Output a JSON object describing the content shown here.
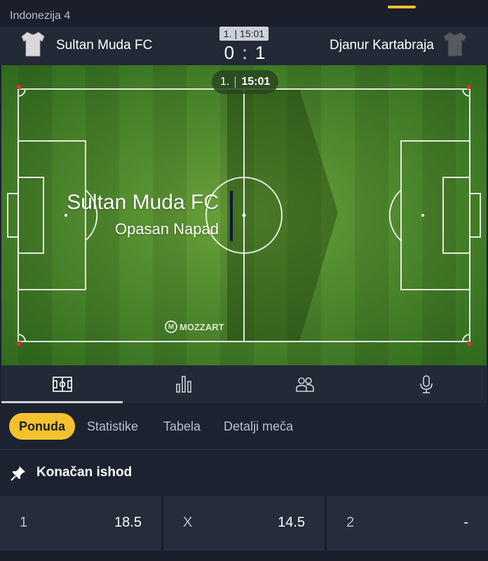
{
  "header": {
    "league": "Indonezija 4"
  },
  "match": {
    "home_team": "Sultan Muda FC",
    "away_team": "Djanur Kartabraja",
    "period": "1.",
    "clock": "15:01",
    "score_home": "0",
    "score_sep": ":",
    "score_away": "1",
    "colors": {
      "home_jersey": "#d8d8d8",
      "away_jersey": "#555a60"
    }
  },
  "pitch": {
    "period": "1.",
    "clock": "15:01",
    "event_team": "Sultan Muda FC",
    "event_action": "Opasan Napad",
    "brand": "MOZZART"
  },
  "tabs": [
    {
      "icon": "pitch-icon",
      "active": true
    },
    {
      "icon": "stats-bars-icon",
      "active": false
    },
    {
      "icon": "lineup-icon",
      "active": false
    },
    {
      "icon": "microphone-icon",
      "active": false
    }
  ],
  "subtabs": {
    "offer": "Ponuda",
    "stats": "Statistike",
    "table": "Tabela",
    "details": "Detalji meča"
  },
  "market": {
    "title": "Konačan ishod",
    "odds": [
      {
        "label": "1",
        "value": "18.5"
      },
      {
        "label": "X",
        "value": "14.5"
      },
      {
        "label": "2",
        "value": "-"
      }
    ]
  },
  "colors": {
    "accent": "#f5c22e",
    "background": "#1c2230",
    "panel": "#222937"
  }
}
